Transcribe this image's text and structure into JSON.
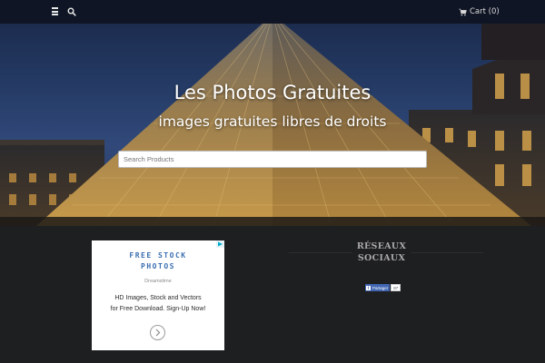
{
  "header": {
    "cart_label": "Cart (0)"
  },
  "hero": {
    "title": "Les Photos Gratuites",
    "subtitle": "images gratuites libres de droits",
    "search_placeholder": "Search Products"
  },
  "ad": {
    "headline_1": "FREE STOCK",
    "headline_2": "PHOTOS",
    "brand": "Dreamstime",
    "line_1": "HD Images, Stock and Vectors",
    "line_2": "for Free Download. Sign-Up Now!"
  },
  "sidebar": {
    "title_1": "RÉSEAUX",
    "title_2": "SOCIAUX",
    "share_label": "Partager",
    "share_count": "87"
  },
  "colors": {
    "topbar": "#0f1524",
    "page_bg": "#1e1f21",
    "ad_headline": "#3a6fb0",
    "facebook": "#4267b2"
  }
}
